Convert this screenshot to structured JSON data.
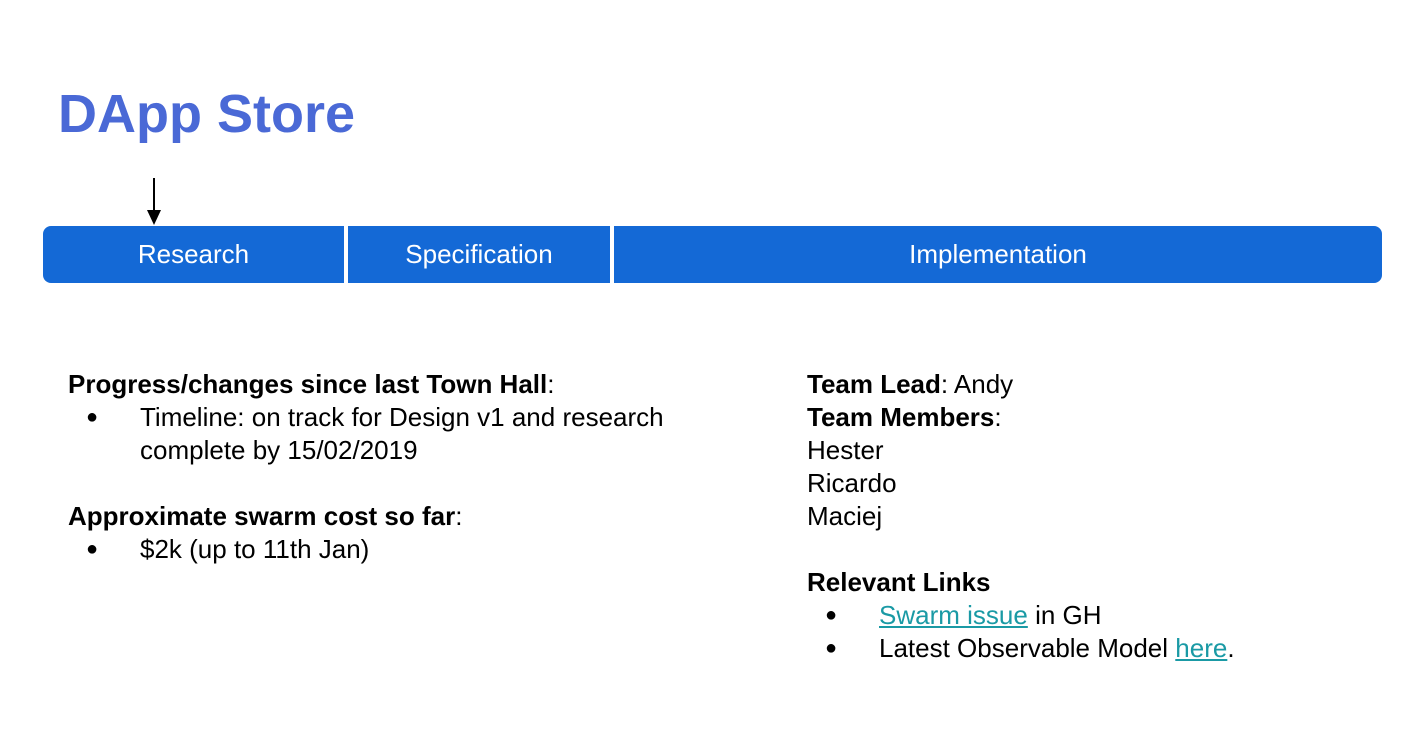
{
  "title": "DApp Store",
  "phases": [
    {
      "label": "Research",
      "current": true
    },
    {
      "label": "Specification",
      "current": false
    },
    {
      "label": "Implementation",
      "current": false
    }
  ],
  "progress": {
    "heading": "Progress/changes since last Town Hall",
    "items": [
      "Timeline: on track for Design v1 and research complete by 15/02/2019"
    ]
  },
  "cost": {
    "heading": "Approximate swarm cost so far",
    "items": [
      "$2k (up to 11th Jan)"
    ]
  },
  "team": {
    "lead_label": "Team Lead",
    "lead_value": "Andy",
    "members_label": "Team Members",
    "members": [
      "Hester",
      "Ricardo",
      "Maciej"
    ]
  },
  "links": {
    "heading": "Relevant Links",
    "item1_link": "Swarm issue",
    "item1_suffix": "in GH",
    "item2_prefix": "Latest Observable Model",
    "item2_link": "here",
    "item2_suffix": "."
  },
  "colors": {
    "title": "#4a69d6",
    "phase_bar": "#1469d6",
    "link": "#1a9aa5"
  },
  "icons": {
    "current_phase_marker": "arrow-down-icon"
  }
}
